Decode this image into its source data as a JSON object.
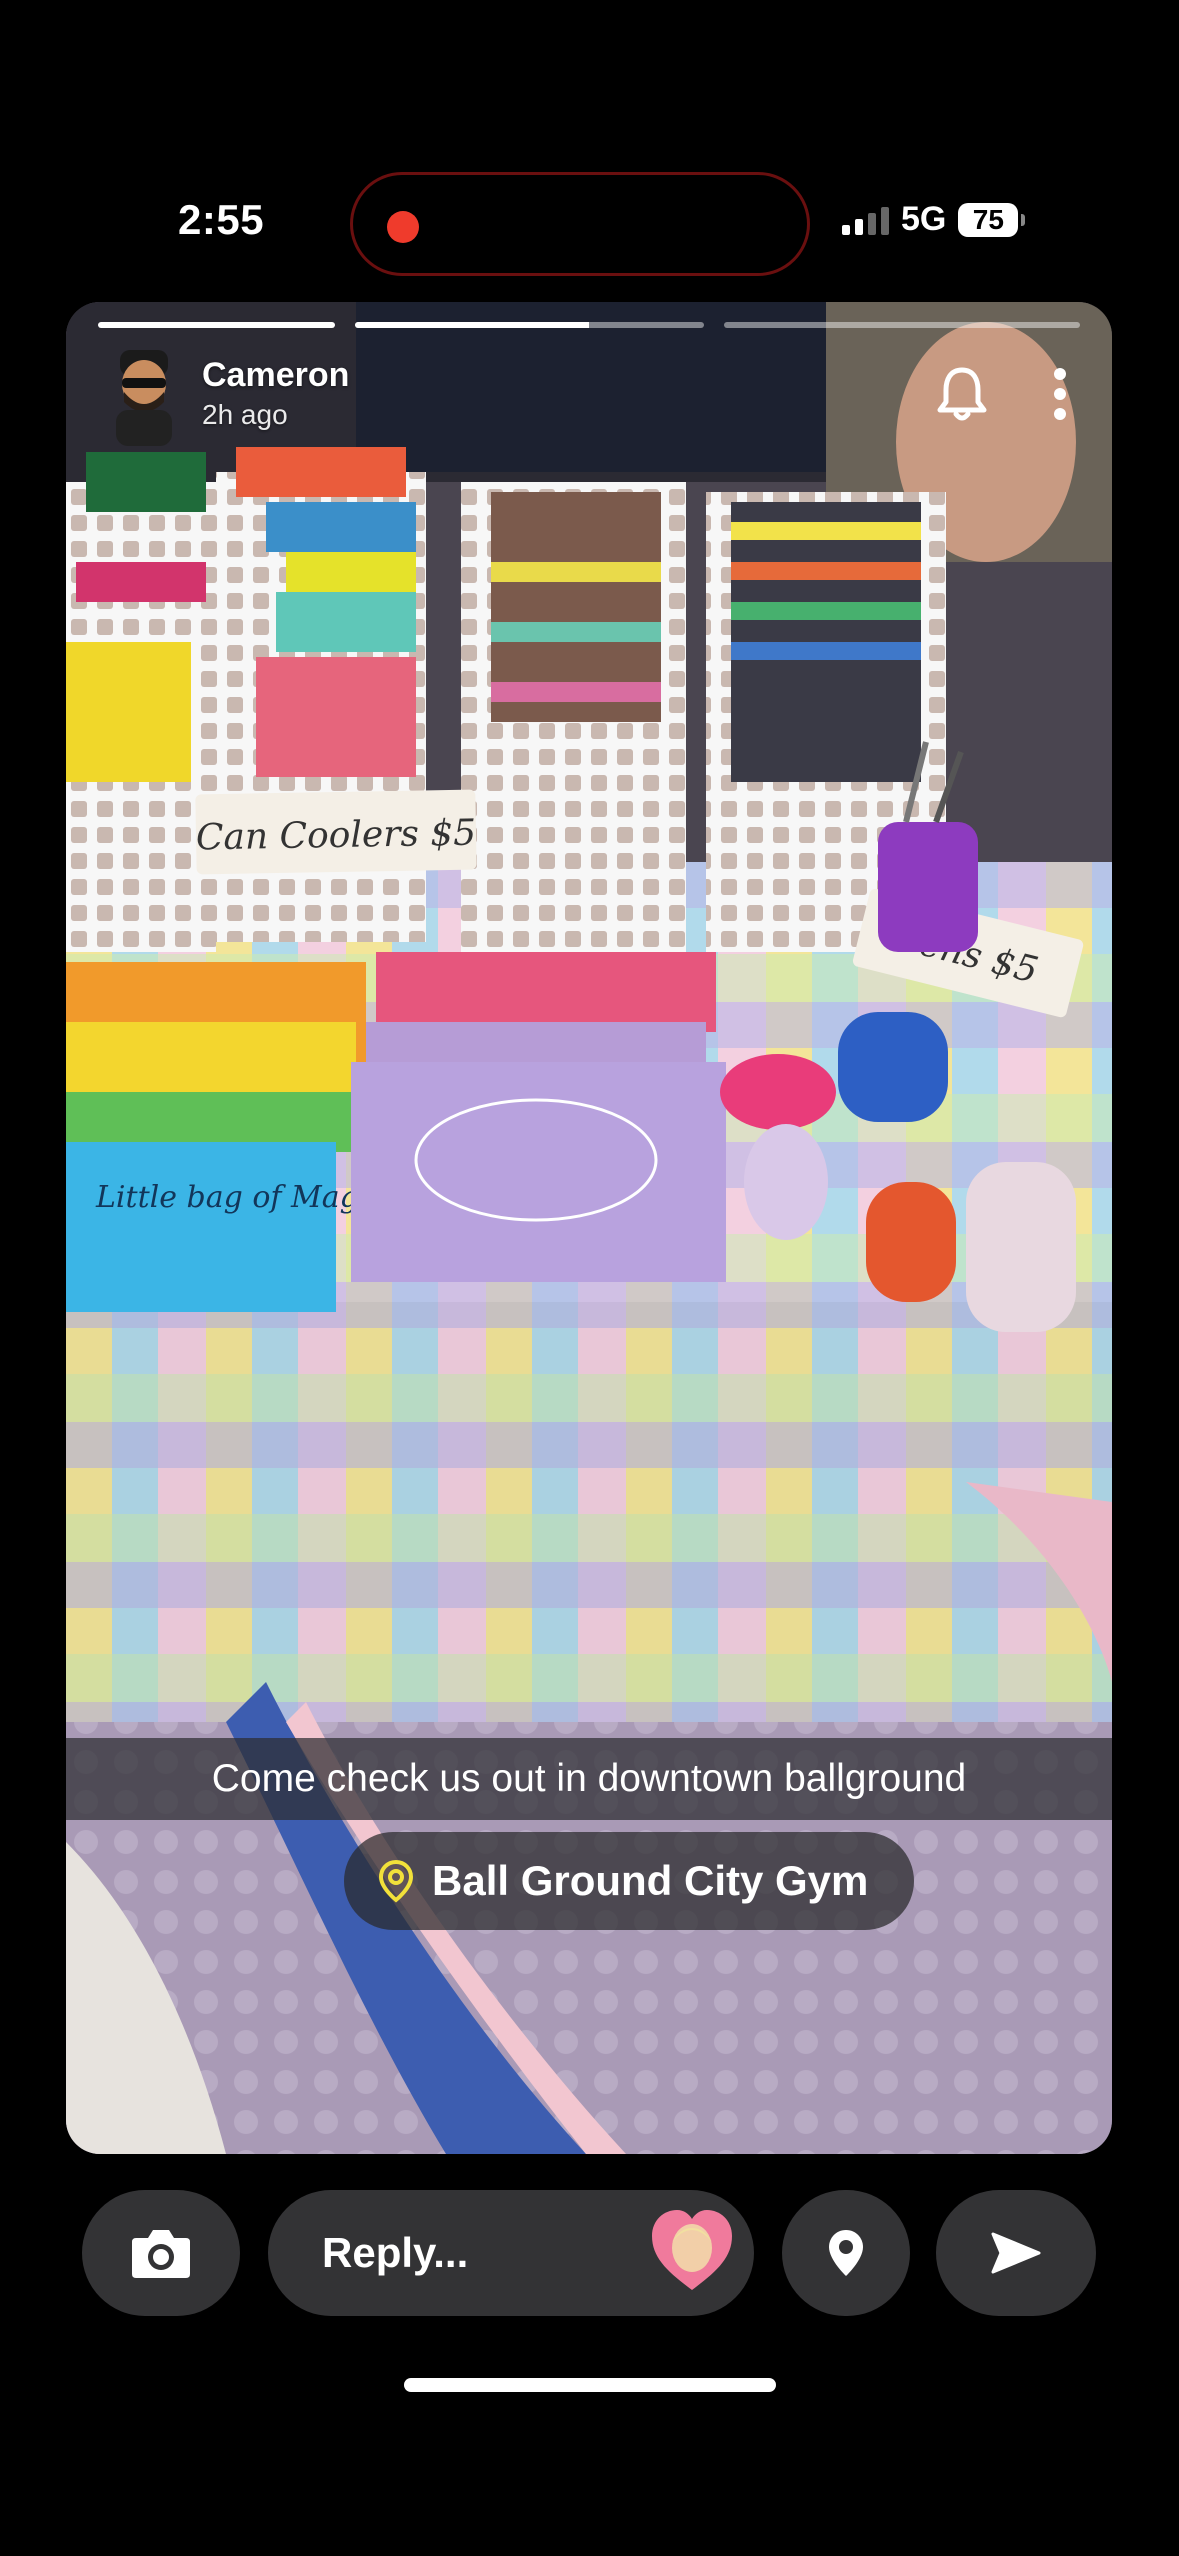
{
  "status_bar": {
    "time": "2:55",
    "network": "5G",
    "battery": "75"
  },
  "story": {
    "progress": [
      1,
      0,
      0
    ],
    "progress_active_fraction": 0.67,
    "user_name": "Cameron",
    "posted_ago": "2h ago",
    "caption": "Come check us out in downtown ballground",
    "location": "Ball Ground City Gym",
    "photo_signs": {
      "can_coolers": "Can Coolers  $5",
      "pens": "Pens $5",
      "bag": "Little bag of Magic"
    }
  },
  "actions": {
    "reply_placeholder": "Reply..."
  },
  "colors": {
    "accent_red": "#ef3b2c",
    "pin_yellow": "#f2e13a",
    "bar_bg": "#333335"
  }
}
